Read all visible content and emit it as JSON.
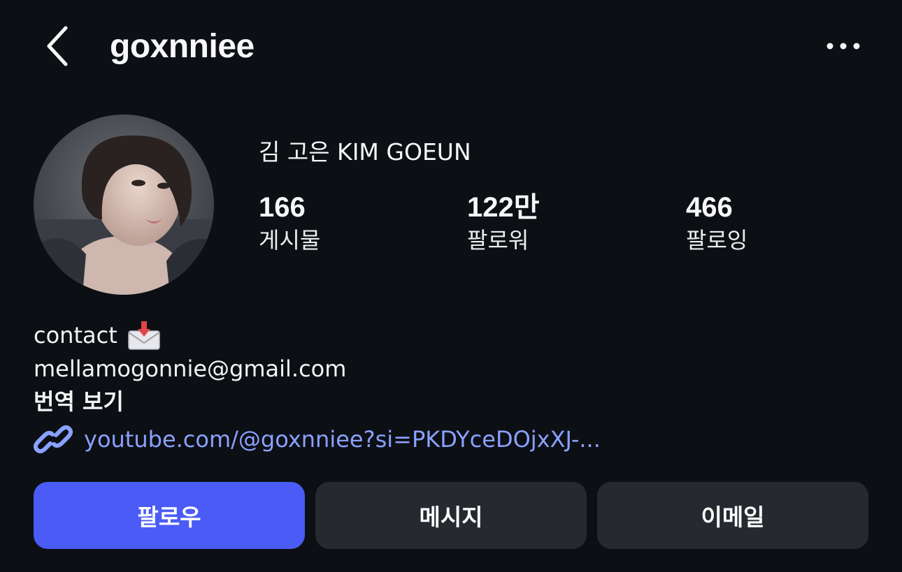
{
  "header": {
    "username": "goxnniee",
    "back_icon": "chevron-left-icon",
    "more_icon": "more-horizontal-icon"
  },
  "profile": {
    "display_name": "김 고은 KIM GOEUN",
    "avatar_icon": "profile-photo"
  },
  "stats": [
    {
      "value": "166",
      "label": "게시물"
    },
    {
      "value": "122만",
      "label": "팔로워"
    },
    {
      "value": "466",
      "label": "팔로잉"
    }
  ],
  "bio": {
    "line1": "contact",
    "line1_icon": "incoming-envelope-icon",
    "line2": "mellamogonnie@gmail.com",
    "translate_label": "번역 보기"
  },
  "link": {
    "icon": "link-icon",
    "text": "youtube.com/@goxnniee?si=PKDYceDOjxXJ-..."
  },
  "actions": {
    "follow_label": "팔로우",
    "message_label": "메시지",
    "email_label": "이메일"
  },
  "colors": {
    "background": "#0c0f14",
    "follow_button": "#4a5cf5",
    "secondary_button": "#26292f",
    "link_text": "#8aa1ff"
  }
}
